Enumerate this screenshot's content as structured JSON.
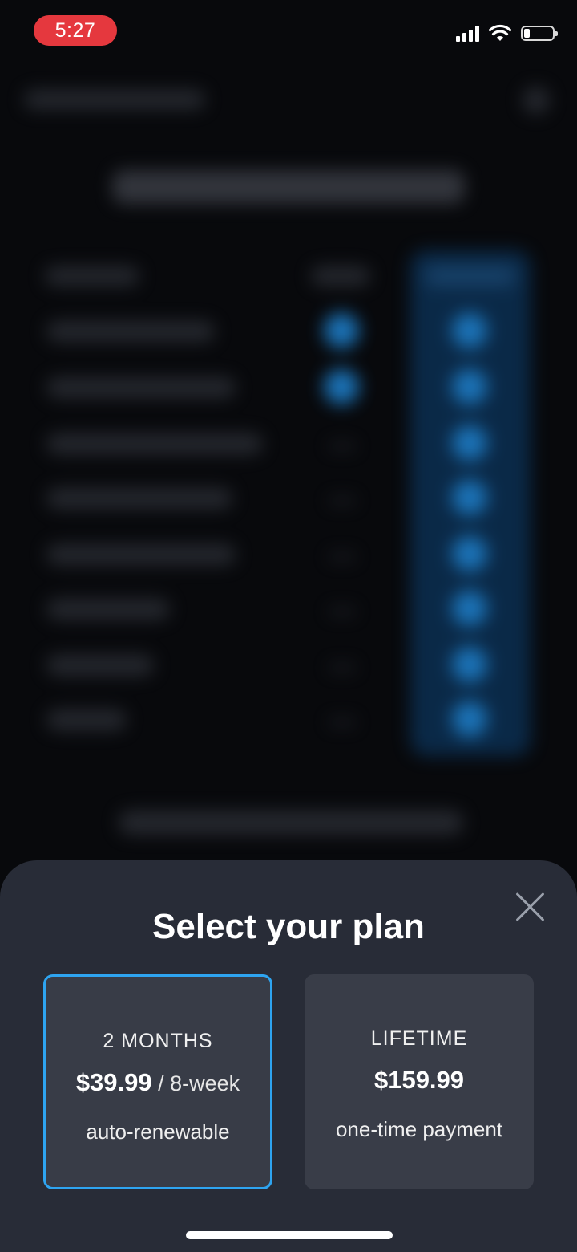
{
  "status_bar": {
    "time": "5:27",
    "signal_icon": "cellular-signal-icon",
    "wifi_icon": "wifi-icon",
    "battery_icon": "battery-icon",
    "battery_level": 0.2,
    "time_pill_color": "#e5383e"
  },
  "sheet": {
    "title": "Select your plan",
    "close_icon": "close-icon",
    "plans": [
      {
        "name": "2 MONTHS",
        "price": "$39.99",
        "period": " / 8-week",
        "note": "auto-renewable",
        "selected": true
      },
      {
        "name": "LIFETIME",
        "price": "$159.99",
        "period": "",
        "note": "one-time payment",
        "selected": false
      }
    ],
    "accent_color": "#2ea4f0",
    "background_color": "#282c37"
  }
}
